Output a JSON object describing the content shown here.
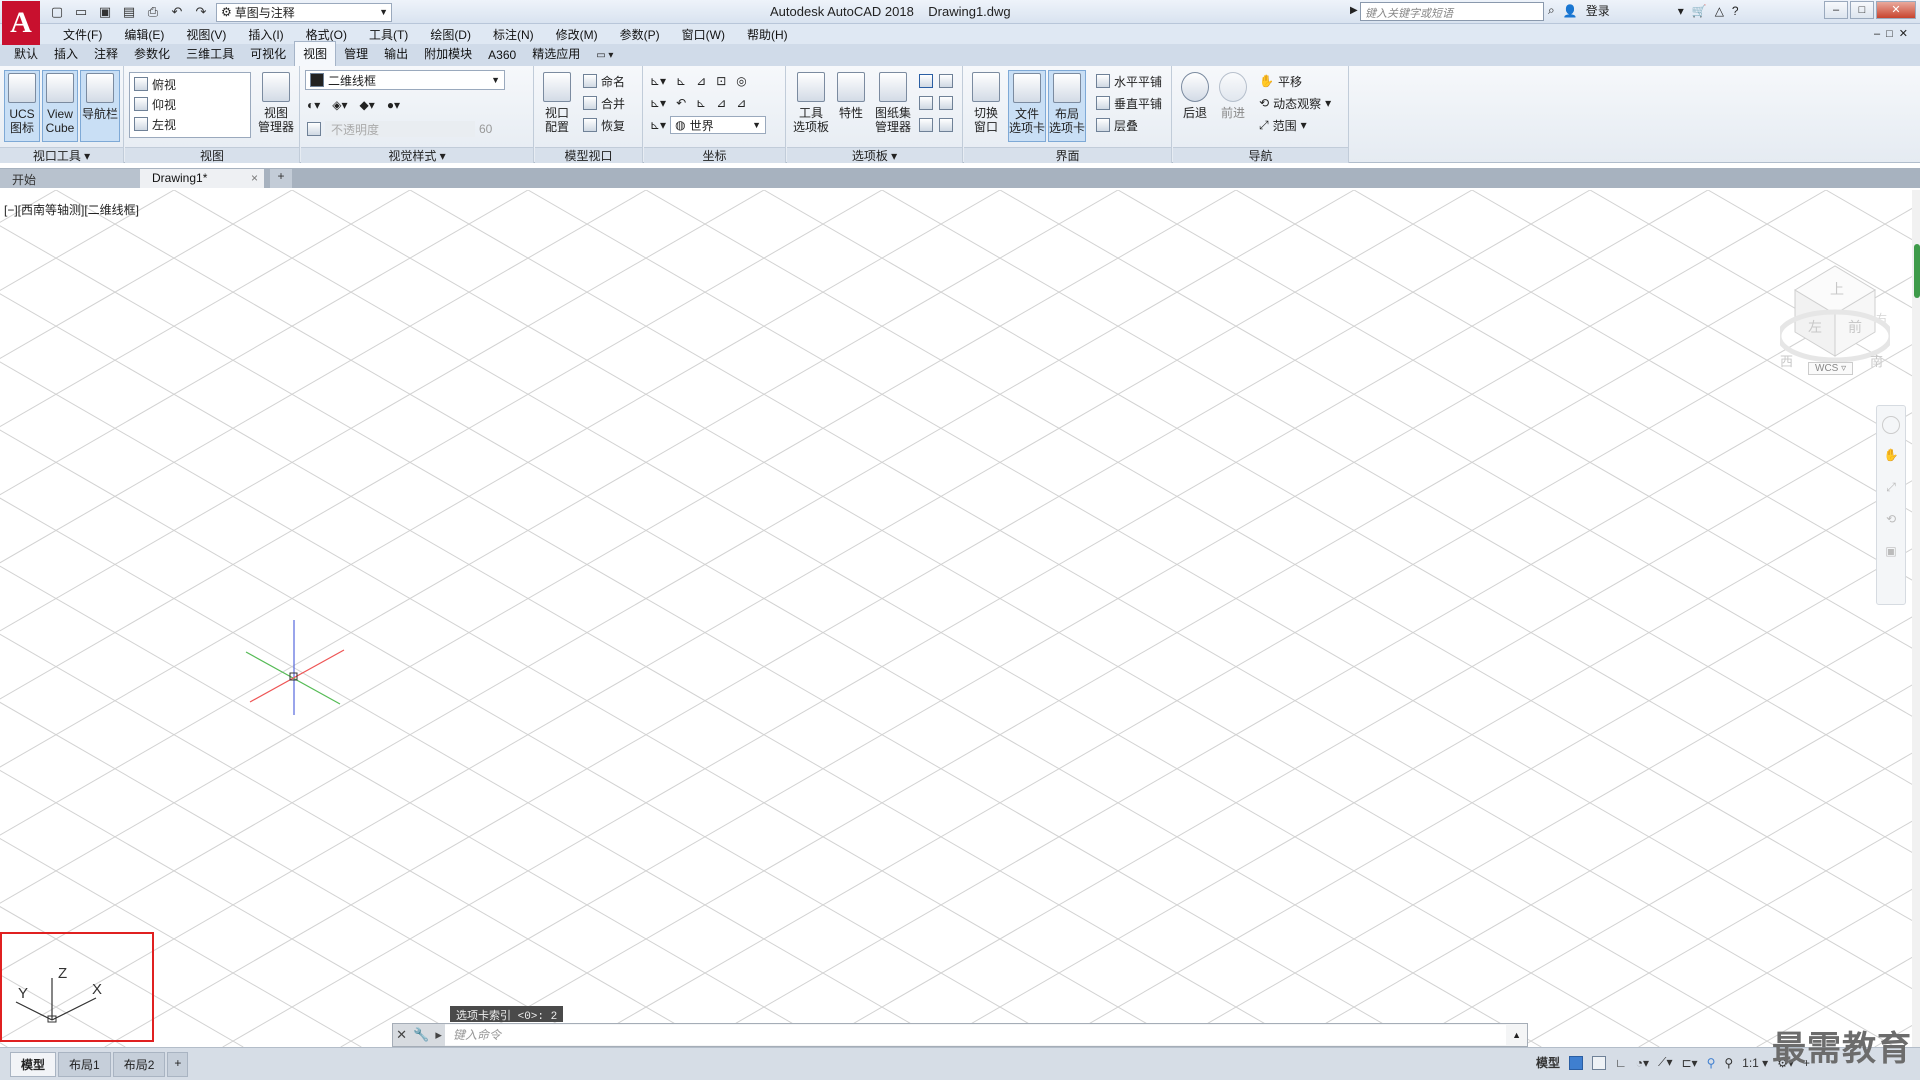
{
  "titlebar": {
    "app_logo": "A",
    "workspace": "草图与注释",
    "title": "Autodesk AutoCAD 2018    Drawing1.dwg",
    "search_placeholder": "键入关键字或短语",
    "login": "登录"
  },
  "menu": [
    "文件(F)",
    "编辑(E)",
    "视图(V)",
    "插入(I)",
    "格式(O)",
    "工具(T)",
    "绘图(D)",
    "标注(N)",
    "修改(M)",
    "参数(P)",
    "窗口(W)",
    "帮助(H)"
  ],
  "ribbon_tabs": [
    "默认",
    "插入",
    "注释",
    "参数化",
    "三维工具",
    "可视化",
    "视图",
    "管理",
    "输出",
    "附加模块",
    "A360",
    "精选应用"
  ],
  "ribbon_active_tab": "视图",
  "ribbon": {
    "viewport_tools": {
      "title": "视口工具 ▾",
      "ucs": "UCS\n图标",
      "viewcube": "View\nCube",
      "navbar": "导航栏"
    },
    "views": {
      "title": "视图",
      "items": [
        "俯视",
        "仰视",
        "左视"
      ],
      "manager": "视图\n管理器"
    },
    "visual_styles": {
      "title": "视觉样式 ▾",
      "current": "二维线框",
      "opacity_label": "不透明度",
      "opacity_value": "60"
    },
    "model_viewports": {
      "title": "模型视口",
      "config": "视口\n配置",
      "named": "命名",
      "join": "合并",
      "restore": "恢复"
    },
    "coordinates": {
      "title": "坐标",
      "world": "世界"
    },
    "palettes": {
      "title": "选项板 ▾",
      "tool_palettes": "工具\n选项板",
      "properties": "特性",
      "sheet_set": "图纸集\n管理器"
    },
    "interface": {
      "title": "界面",
      "switch_window": "切换\n窗口",
      "file_tabs": "文件\n选项卡",
      "layout_tabs": "布局\n选项卡",
      "tile_h": "水平平铺",
      "tile_v": "垂直平铺",
      "cascade": "层叠"
    },
    "navigate": {
      "title": "导航",
      "back": "后退",
      "forward": "前进",
      "pan": "平移",
      "orbit": "动态观察",
      "extents": "范围"
    }
  },
  "doc_tabs": {
    "start": "开始",
    "active": "Drawing1*",
    "close": "×",
    "add": "+"
  },
  "drawing": {
    "viewport_label": "[−][西南等轴测][二维线框]",
    "viewcube_faces": {
      "top": "上",
      "front": "前",
      "left": "左",
      "right": "右"
    },
    "viewcube_compass": {
      "west": "西",
      "south": "南"
    },
    "wcs": "WCS ▿",
    "ucs_axes": {
      "x": "X",
      "y": "Y",
      "z": "Z"
    }
  },
  "command": {
    "hint": "选项卡索引 <0>: 2",
    "placeholder": "键入命令"
  },
  "statusbar": {
    "layouts": [
      "模型",
      "布局1",
      "布局2"
    ],
    "add": "+",
    "model_label": "模型",
    "scale": "1:1 ▾"
  },
  "watermark": "最需教育",
  "colors": {
    "accent": "#3f7fd0",
    "highlight_box": "#e02020",
    "logo": "#c8102e"
  }
}
